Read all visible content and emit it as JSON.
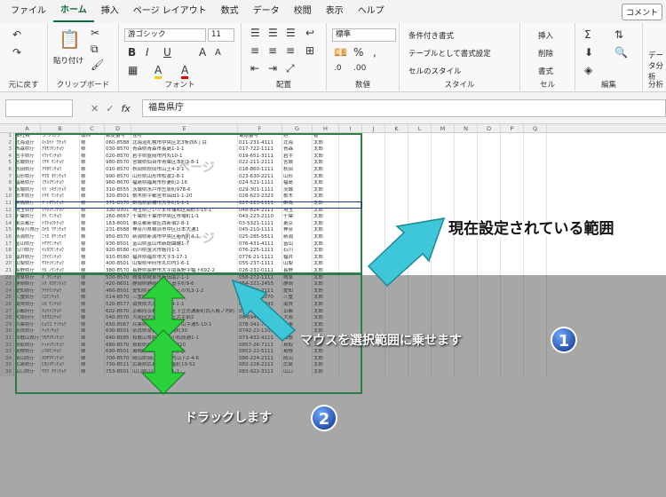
{
  "menu": {
    "tabs": [
      "ファイル",
      "ホーム",
      "挿入",
      "ページ レイアウト",
      "数式",
      "データ",
      "校閲",
      "表示",
      "ヘルプ"
    ],
    "comment": "コメント"
  },
  "ribbon": {
    "undo_group": "元に戻す",
    "clipboard": {
      "label": "クリップボード",
      "paste": "貼り付け"
    },
    "font": {
      "label": "フォント",
      "name": "游ゴシック",
      "size": "11",
      "bold": "B",
      "italic": "I",
      "underline": "U",
      "grow": "A",
      "shrink": "A",
      "fill": "A",
      "color": "A"
    },
    "align": {
      "label": "配置"
    },
    "number": {
      "label": "数値",
      "format": "標準",
      "percent": "%"
    },
    "styles": {
      "label": "スタイル",
      "cond": "条件付き書式",
      "table": "テーブルとして書式設定",
      "cell": "セルのスタイル"
    },
    "cells": {
      "label": "セル",
      "insert": "挿入",
      "delete": "削除",
      "format": "書式"
    },
    "edit": {
      "label": "編集",
      "data": "データ分析",
      "analysis": "分析"
    }
  },
  "formula": {
    "value": "福島県庁",
    "fx": "fx"
  },
  "columns": [
    "A",
    "B",
    "C",
    "D",
    "E",
    "F",
    "G",
    "H",
    "I",
    "J",
    "K",
    "L",
    "M",
    "N",
    "O",
    "P",
    "Q"
  ],
  "header_row": [
    "会社名",
    "フリガナ",
    "敬称",
    "郵便番号",
    "住所",
    "電話番号",
    "担",
    "者"
  ],
  "rows": [
    [
      "北海道庁",
      "ﾎｯｶｲﾄﾞｳﾁｮｳ",
      "様",
      "060-8588",
      "北海道札幌市中央区北3条西6丁目",
      "011-231-4111",
      "北海",
      "太郎"
    ],
    [
      "青森県庁",
      "ｱｵﾓﾘｹﾝﾁｮｳ",
      "様",
      "030-8570",
      "青森県青森市長島1-1-1",
      "017-722-1111",
      "青森",
      "太郎"
    ],
    [
      "岩手県庁",
      "ｲﾜﾃｹﾝﾁｮｳ",
      "様",
      "020-8570",
      "岩手県盛岡市内丸10-1",
      "019-651-3111",
      "岩手",
      "太郎"
    ],
    [
      "宮城県庁",
      "ﾐﾔｷﾞｹﾝﾁｮｳ",
      "様",
      "980-8570",
      "宮城県仙台市青葉区本町3-8-1",
      "022-211-2111",
      "宮城",
      "太郎"
    ],
    [
      "秋田県庁",
      "ｱｷﾀｹﾝﾁｮｳ",
      "様",
      "010-8570",
      "秋田県秋田市山王4-1-1",
      "018-860-1111",
      "秋田",
      "太郎"
    ],
    [
      "山形県庁",
      "ﾔﾏｶﾞﾀｹﾝﾁｮｳ",
      "様",
      "990-8570",
      "山形県山形市松波2-8-1",
      "023-630-2211",
      "山形",
      "太郎"
    ],
    [
      "福島県庁",
      "ﾌｸｼﾏｹﾝﾁｮｳ",
      "様",
      "960-8670",
      "福島県福島市杉妻町2-16",
      "024-521-1111",
      "福島",
      "太郎"
    ],
    [
      "茨城県庁",
      "ｲﾊﾞﾗｷｹﾝﾁｮｳ",
      "様",
      "310-8555",
      "茨城県水戸市笠原町978-6",
      "029-301-1111",
      "茨城",
      "太郎"
    ],
    [
      "栃木県庁",
      "ﾄﾁｷﾞｹﾝﾁｮｳ",
      "様",
      "320-8501",
      "栃木県宇都宮市塙田1-1-20",
      "028-623-2323",
      "栃木",
      "太郎"
    ],
    [
      "群馬県庁",
      "ｸﾞﾝﾏｹﾝﾁｮｳ",
      "様",
      "371-8570",
      "群馬県前橋市大手町1-1-1",
      "027-223-1111",
      "群馬",
      "太郎"
    ],
    [
      "埼玉県庁",
      "ｻｲﾀﾏｹﾝﾁｮｳ",
      "様",
      "330-9301",
      "埼玉県さいたま市浦和区高砂3-15-1",
      "048-824-2111",
      "埼玉",
      "太郎"
    ],
    [
      "千葉県庁",
      "ﾁﾊﾞｹﾝﾁｮｳ",
      "様",
      "260-8667",
      "千葉県千葉市中央区市場町1-1",
      "043-223-2110",
      "千葉",
      "太郎"
    ],
    [
      "東京都庁",
      "ﾄｳｷｮｳﾄﾁｮｳ",
      "様",
      "163-8001",
      "東京都新宿区西新宿2-8-1",
      "03-5321-1111",
      "東京",
      "太郎"
    ],
    [
      "神奈川県庁",
      "ｶﾅｶﾞﾜｹﾝﾁｮｳ",
      "様",
      "231-8588",
      "神奈川県横浜市中区日本大通1",
      "045-210-1111",
      "神奈",
      "太郎"
    ],
    [
      "新潟県庁",
      "ﾆｲｶﾞﾀｹﾝﾁｮｳ",
      "様",
      "950-8570",
      "新潟県新潟市中央区新光町4-1",
      "025-285-5511",
      "新潟",
      "太郎"
    ],
    [
      "富山県庁",
      "ﾄﾔﾏｹﾝﾁｮｳ",
      "様",
      "930-8501",
      "富山県富山市新総曲輪1-7",
      "076-431-4111",
      "富山",
      "太郎"
    ],
    [
      "石川県庁",
      "ｲｼｶﾜｹﾝﾁｮｳ",
      "様",
      "920-8580",
      "石川県金沢市鞍月1-1",
      "076-225-1111",
      "石川",
      "太郎"
    ],
    [
      "福井県庁",
      "ﾌｸｲｹﾝﾁｮｳ",
      "様",
      "910-8580",
      "福井県福井市大手3-17-1",
      "0776-21-1111",
      "福井",
      "太郎"
    ],
    [
      "山梨県庁",
      "ﾔﾏﾅｼｹﾝﾁｮｳ",
      "様",
      "400-8501",
      "山梨県甲府市丸の内1-6-1",
      "055-237-1111",
      "山梨",
      "太郎"
    ],
    [
      "長野県庁",
      "ﾅｶﾞﾉｹﾝﾁｮｳ",
      "様",
      "380-8570",
      "長野県長野市大字南長野字幅下692-2",
      "026-232-0111",
      "長野",
      "太郎"
    ],
    [
      "岐阜県庁",
      "ｷﾞﾌｹﾝﾁｮｳ",
      "様",
      "500-8570",
      "岐阜県岐阜市薮田南2-1-1",
      "058-272-1111",
      "岐阜",
      "太郎"
    ],
    [
      "静岡県庁",
      "ｼｽﾞｵｶｹﾝﾁｮｳ",
      "様",
      "420-8601",
      "静岡県静岡市葵区追手町9-6",
      "054-221-2455",
      "静岡",
      "太郎"
    ],
    [
      "愛知県庁",
      "ｱｲﾁｹﾝﾁｮｳ",
      "様",
      "460-8501",
      "愛知県名古屋市中区三の丸3-1-2",
      "052-961-2111",
      "愛知",
      "太郎"
    ],
    [
      "三重県庁",
      "ﾐｴｹﾝﾁｮｳ",
      "様",
      "514-8570",
      "三重県津市広明町13",
      "059-224-3070",
      "三重",
      "太郎"
    ],
    [
      "滋賀県庁",
      "ｼｶﾞｹﾝﾁｮｳ",
      "様",
      "520-8577",
      "滋賀県大津市京町4-1-1",
      "077-528-3993",
      "滋賀",
      "太郎"
    ],
    [
      "京都府庁",
      "ｷｮｳﾄﾌﾁｮｳ",
      "様",
      "602-8570",
      "京都府京都市上京区下立売通新町西入薮ノ内町",
      "075-451-8111",
      "京都",
      "太郎"
    ],
    [
      "大阪府庁",
      "ｵｵｻｶﾌﾁｮｳ",
      "様",
      "540-8570",
      "大阪府大阪市中央区大手前2",
      "06-6941-0351",
      "大阪",
      "太郎"
    ],
    [
      "兵庫県庁",
      "ﾋｮｳｺﾞｹﾝﾁｮｳ",
      "様",
      "650-8567",
      "兵庫県神戸市中央区下山手通5-10-1",
      "078-341-7711",
      "兵庫",
      "太郎"
    ],
    [
      "奈良県庁",
      "ﾅﾗｹﾝﾁｮｳ",
      "様",
      "630-8501",
      "奈良県奈良市登大路町30",
      "0742-22-1101",
      "奈良",
      "太郎"
    ],
    [
      "和歌山県庁",
      "ﾜｶﾔﾏｹﾝﾁｮｳ",
      "様",
      "640-8585",
      "和歌山県和歌山市小松原通1-1",
      "073-432-4111",
      "和歌",
      "太郎"
    ],
    [
      "鳥取県庁",
      "ﾄｯﾄﾘｹﾝﾁｮｳ",
      "様",
      "680-8570",
      "鳥取県鳥取市東町1-220",
      "0857-26-7111",
      "鳥取",
      "太郎"
    ],
    [
      "島根県庁",
      "ｼﾏﾈｹﾝﾁｮｳ",
      "様",
      "690-8501",
      "島根県松江市殿町1番地",
      "0852-22-5111",
      "島根",
      "太郎"
    ],
    [
      "岡山県庁",
      "ｵｶﾔﾏｹﾝﾁｮｳ",
      "様",
      "700-8570",
      "岡山県岡山市北区内山下2-4-6",
      "086-224-2111",
      "岡山",
      "太郎"
    ],
    [
      "広島県庁",
      "ﾋﾛｼﾏｹﾝﾁｮｳ",
      "様",
      "730-8511",
      "広島県広島市中区基町10-52",
      "082-228-2111",
      "広島",
      "太郎"
    ],
    [
      "山口県庁",
      "ﾔﾏｸﾞﾁｹﾝﾁｮｳ",
      "様",
      "753-8501",
      "山口県山口市滝町1-1",
      "083-922-3111",
      "山口",
      "太郎"
    ]
  ],
  "annotations": {
    "current_range": "現在設定されている範囲",
    "hover": "マウスを選択範囲に乗せます",
    "drag": "ドラックします",
    "badge1": "1",
    "badge2": "2",
    "ghost": "ページ"
  },
  "colors": {
    "accent": "#0f6b3a",
    "arrow_cyan": "#3ec7d8",
    "arrow_green": "#2ad13a"
  }
}
